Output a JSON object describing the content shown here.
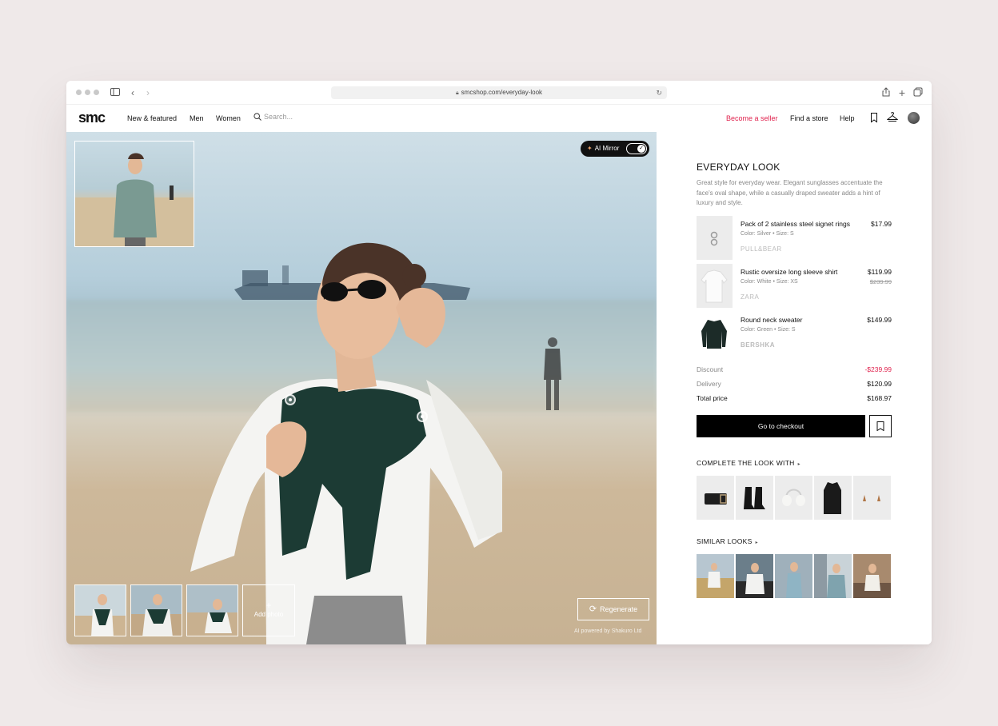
{
  "browser": {
    "url": "smcshop.com/everyday-look",
    "back_icon": "chevron-left-icon",
    "forward_icon": "chevron-right-icon"
  },
  "nav": {
    "logo": "smc",
    "links": [
      "New & featured",
      "Men",
      "Women"
    ],
    "search_placeholder": "Search...",
    "become_seller": "Become a seller",
    "find_store": "Find a store",
    "help": "Help",
    "accent_color": "#e0244f"
  },
  "hero": {
    "ai_mirror_label": "AI Mirror",
    "ai_mirror_on": true,
    "add_photo_label": "Add photo",
    "regenerate_label": "Regenerate",
    "powered_by": "AI powered by Shakuro Ltd"
  },
  "look": {
    "title": "EVERYDAY LOOK",
    "description": "Great style for everyday wear. Elegant sunglasses accentuate the face's oval shape, while a casually draped sweater adds a hint of luxury and style.",
    "items": [
      {
        "name": "Pack of 2 stainless steel signet rings",
        "meta": "Color: Silver  •  Size: S",
        "brand": "PULL&BEAR",
        "price": "$17.99",
        "old_price": ""
      },
      {
        "name": "Rustic oversize long sleeve shirt",
        "meta": "Color: White  •  Size: XS",
        "brand": "ZARA",
        "price": "$119.99",
        "old_price": "$239.99"
      },
      {
        "name": "Round neck sweater",
        "meta": "Color: Green  •  Size: S",
        "brand": "BERSHKA",
        "price": "$149.99",
        "old_price": ""
      }
    ],
    "summary": {
      "discount_label": "Discount",
      "discount": "-$239.99",
      "delivery_label": "Delivery",
      "delivery": "$120.99",
      "total_label": "Total price",
      "total": "$168.97"
    },
    "checkout_label": "Go to checkout",
    "complete_title": "COMPLETE THE LOOK WITH",
    "similar_title": "SIMILAR LOOKS"
  }
}
